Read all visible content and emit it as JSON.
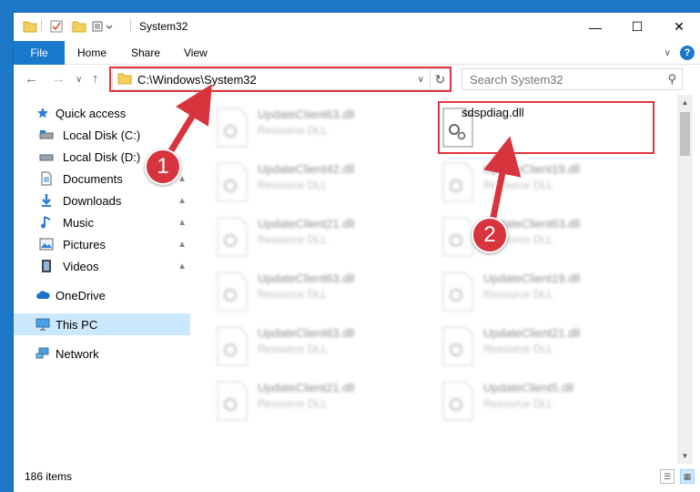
{
  "window": {
    "title": "System32"
  },
  "ribbon": {
    "tabs": [
      "File",
      "Home",
      "Share",
      "View"
    ]
  },
  "nav": {
    "address": "C:\\Windows\\System32",
    "search_placeholder": "Search System32"
  },
  "sidebar": {
    "items": [
      {
        "label": "Quick access",
        "icon": "star-icon"
      },
      {
        "label": "Local Disk (C:)",
        "icon": "drive-icon"
      },
      {
        "label": "Local Disk (D:)",
        "icon": "drive-icon"
      },
      {
        "label": "Documents",
        "icon": "documents-icon"
      },
      {
        "label": "Downloads",
        "icon": "download-icon"
      },
      {
        "label": "Music",
        "icon": "music-icon"
      },
      {
        "label": "Pictures",
        "icon": "pictures-icon"
      },
      {
        "label": "Videos",
        "icon": "videos-icon"
      },
      {
        "label": "OneDrive",
        "icon": "cloud-icon"
      },
      {
        "label": "This PC",
        "icon": "computer-icon"
      },
      {
        "label": "Network",
        "icon": "network-icon"
      }
    ]
  },
  "files": {
    "highlighted": {
      "name": "sdspdiag.dll"
    },
    "left_column": [
      {
        "name": "UpdateClient63.dll",
        "type": "Resource DLL"
      },
      {
        "name": "UpdateClient42.dll",
        "type": "Resource DLL"
      },
      {
        "name": "UpdateClient21.dll",
        "type": "Resource DLL"
      },
      {
        "name": "UpdateClient63.dll",
        "type": "Resource DLL"
      },
      {
        "name": "UpdateClient63.dll",
        "type": "Resource DLL"
      },
      {
        "name": "UpdateClient21.dll",
        "type": "Resource DLL"
      }
    ],
    "right_column": [
      {
        "name": "UpdateClient19.dll",
        "type": "Resource DLL"
      },
      {
        "name": "UpdateClient63.dll",
        "type": "Resource DLL"
      },
      {
        "name": "UpdateClient19.dll",
        "type": "Resource DLL"
      },
      {
        "name": "UpdateClient21.dll",
        "type": "Resource DLL"
      },
      {
        "name": "UpdateClient5.dll",
        "type": "Resource DLL"
      }
    ]
  },
  "status": {
    "count": "186 items"
  },
  "annotations": {
    "step1": "1",
    "step2": "2",
    "color": "#e0353d"
  }
}
